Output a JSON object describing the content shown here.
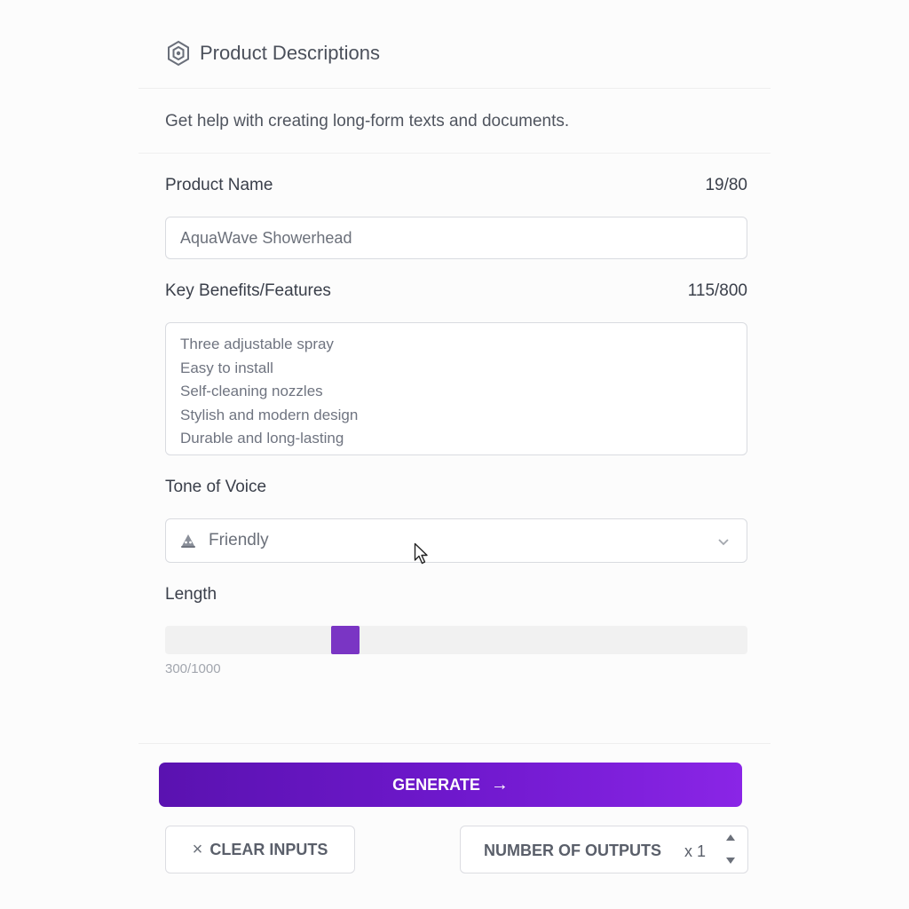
{
  "header": {
    "title": "Product Descriptions",
    "icon": "hexagon-logo-icon"
  },
  "description": "Get help with creating long-form texts and documents.",
  "product_name": {
    "label": "Product Name",
    "counter": "19/80",
    "value": "AquaWave Showerhead"
  },
  "benefits": {
    "label": "Key Benefits/Features",
    "counter": "115/800",
    "lines": [
      "Three adjustable spray",
      "Easy to install",
      "Self-cleaning nozzles",
      "Stylish and modern design",
      "Durable and long-lasting"
    ]
  },
  "tone": {
    "label": "Tone of Voice",
    "selected": "Friendly",
    "icon": "friendly-emoji-icon"
  },
  "length": {
    "label": "Length",
    "value_text": "300/1000",
    "fraction": 0.3
  },
  "actions": {
    "generate_label": "GENERATE",
    "clear_label": "CLEAR INPUTS",
    "outputs_label": "NUMBER OF OUTPUTS",
    "outputs_value": "x 1"
  },
  "colors": {
    "accent": "#7a35c4",
    "generate_start": "#5a12b0",
    "generate_end": "#8a25e6"
  }
}
